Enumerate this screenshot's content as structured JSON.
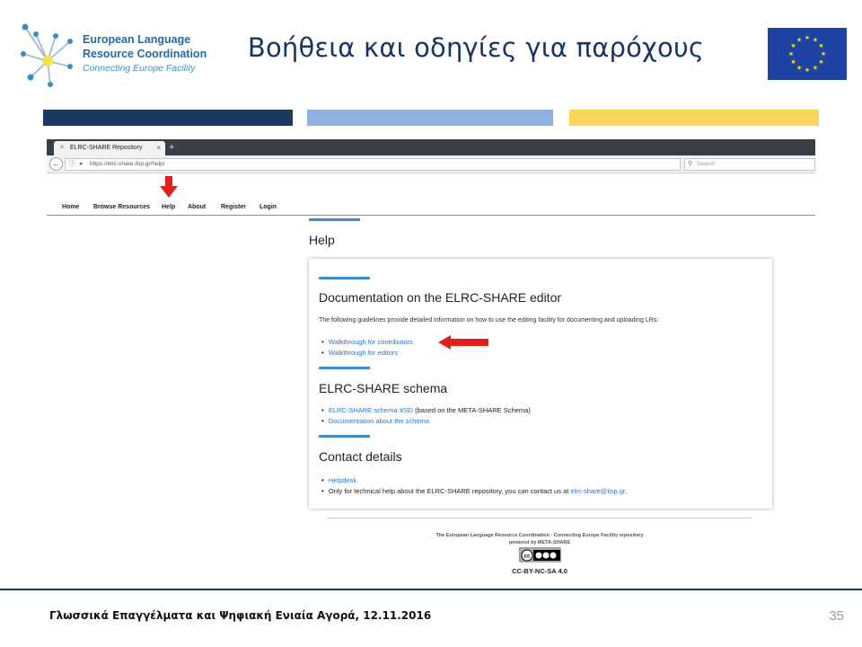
{
  "slide": {
    "title": "Βοήθεια και οδηγίες για παρόχους",
    "logo": {
      "line1": "European Language",
      "line2": "Resource Coordination",
      "line3": "Connecting Europe Facility"
    },
    "footer_text": "Γλωσσικά Επαγγέλματα και Ψηφιακή Ενιαία Αγορά, 12.11.2016",
    "page_number": "35",
    "colors": {
      "title": "#1a3560",
      "bar_dark": "#1b3a5f",
      "bar_light": "#8eb1df",
      "bar_yellow": "#f7d659",
      "eu_blue": "#1d43a3",
      "eu_gold": "#ffdd00",
      "link": "#2b73c9",
      "arrow_red": "#e0201b"
    }
  },
  "browser": {
    "tab_title": "ELRC-SHARE Repository",
    "tab_close": "×",
    "tab_new": "+",
    "back_glyph": "←",
    "url_info_glyph": "ⓘ",
    "url_lock_glyph": "🔒",
    "url": "https://elrc-share.ilsp.gr/help/",
    "reload_glyph": "C",
    "search_icon_glyph": "⚲",
    "search_placeholder": "Search"
  },
  "site": {
    "nav": [
      "Home",
      "Browse Resources",
      "Help",
      "About",
      "Register",
      "Login"
    ],
    "page_heading": "Help",
    "sections": [
      {
        "title": "Documentation on the ELRC-SHARE editor",
        "intro": "The following guidelines provide detailed information on how to use the editing facility for documenting and uploading LRs:",
        "items": [
          {
            "link": "Walkthrough for contributors",
            "text": ""
          },
          {
            "link": "Walkthrough for editors",
            "text": ""
          }
        ]
      },
      {
        "title": "ELRC-SHARE schema",
        "items": [
          {
            "link": "ELRC-SHARE schema XSD",
            "text": " (based on the META-SHARE Schema)"
          },
          {
            "link": "Documentation about the schema",
            "text": ""
          }
        ]
      },
      {
        "title": "Contact details",
        "items": [
          {
            "link": "Helpdesk",
            "text": ""
          },
          {
            "text": "Only for technical help about the ELRC-SHARE repository, you can contact us at ",
            "link": "elrc-share@ilsp.gr",
            "suffix": "."
          }
        ]
      }
    ],
    "footer": {
      "line1": "The European Language Resource Coordination - Connecting Europe Facility repository",
      "line2": "powered by META-SHARE",
      "badge_text": "cc by nc sa",
      "license": "CC-BY-NC-SA 4.0"
    }
  }
}
